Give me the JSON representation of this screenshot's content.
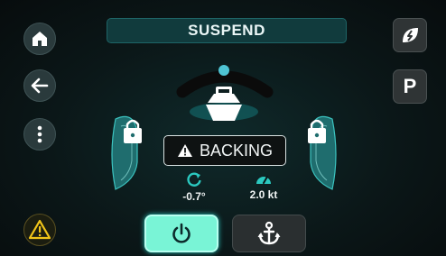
{
  "header": {
    "title": "SUSPEND"
  },
  "status": {
    "label": "BACKING"
  },
  "readouts": [
    {
      "icon": "rotation-icon",
      "value": "-0.7°"
    },
    {
      "icon": "speedometer-icon",
      "value": "2.0 kt"
    }
  ],
  "right_panel": {
    "park_label": "P"
  },
  "colors": {
    "accent": "#2bc9c0",
    "power_button": "#79f4d6",
    "warning": "#f0c419",
    "thruster": "#2ab8b4"
  },
  "icons": [
    "home-icon",
    "back-arrow-icon",
    "more-vert-icon",
    "warning-icon",
    "eco-leaf-icon",
    "lock-icon",
    "boat-icon",
    "power-icon",
    "anchor-icon"
  ]
}
